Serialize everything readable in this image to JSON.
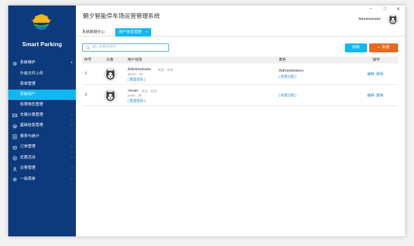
{
  "brand": {
    "name": "Smart Parking",
    "logo": "sun-over-waves-logo"
  },
  "app": {
    "title": "朝夕智能停车场运营管理系统",
    "user": "Administrator",
    "window_controls": {
      "minimize": "–",
      "maximize": "□",
      "close": "✕"
    }
  },
  "sidebar": {
    "items": [
      {
        "label": "系统维护",
        "icon": "gear-icon",
        "arrow": "▾"
      },
      {
        "label": "升级文件上传"
      },
      {
        "label": "菜单管理"
      },
      {
        "label": "系统用户"
      },
      {
        "label": "权限角色管理"
      },
      {
        "label": "车辆计费管理",
        "icon": "car-billing-icon",
        "arrow": "›"
      },
      {
        "label": "基础信息管理",
        "icon": "layers-icon",
        "arrow": "›"
      },
      {
        "label": "报表与统计",
        "icon": "report-icon",
        "arrow": "›"
      },
      {
        "label": "订单管理",
        "icon": "order-icon",
        "arrow": "›"
      },
      {
        "label": "优惠活动",
        "icon": "promotion-icon",
        "arrow": "›"
      },
      {
        "label": "访客管理",
        "icon": "visitor-icon",
        "arrow": "›"
      },
      {
        "label": "一级菜单",
        "icon": "settings-icon",
        "arrow": "›"
      }
    ]
  },
  "tabs": [
    {
      "label": "系统数据中心"
    },
    {
      "label": "用户信息管理",
      "close": "×"
    }
  ],
  "toolbar": {
    "search_placeholder": "输入关键词查询",
    "refresh_label": "刷新",
    "add_label": "新增",
    "add_icon": "+"
  },
  "table": {
    "headers": {
      "index": "序号",
      "avatar": "头像",
      "info": "用户信息",
      "role": "角色",
      "ops": "操作"
    },
    "rows": [
      {
        "index": "1",
        "name": "Administrator",
        "state": "状态：有效",
        "account": "admin · 30",
        "reset": "[ 重置密码 ]",
        "role": "Administrators",
        "assign": "[ 权限分配 ]",
        "edit": "编辑",
        "delete": "删除"
      },
      {
        "index": "2",
        "name": "Jovan",
        "state": "状态：有效",
        "account": "jovan · 30",
        "reset": "[ 重置密码 ]",
        "role": "",
        "assign": "[ 权限分配 ]",
        "edit": "编辑",
        "delete": "删除"
      }
    ]
  },
  "colors": {
    "sidebar_bg": "#0c3a7c",
    "accent": "#0fb8f0",
    "add_button": "#e86a1f",
    "link": "#1f88d8"
  }
}
